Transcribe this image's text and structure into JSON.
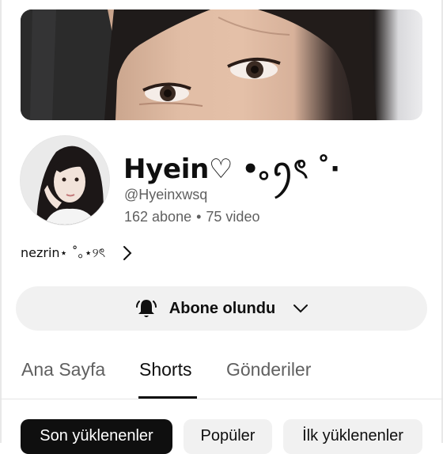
{
  "channel": {
    "name": "Hyein♡ •｡ꪆৎ ˚⋅",
    "handle": "@Hyeinxwsq",
    "subscribers": "162 abone",
    "separator": "•",
    "videos": "75 video",
    "link_text": "nezrin⋆ ˚｡⋆୨ৎ"
  },
  "subscribe": {
    "label": "Abone olundu",
    "icon": "bell-filled-icon"
  },
  "tabs": [
    {
      "label": "Ana Sayfa",
      "active": false
    },
    {
      "label": "Shorts",
      "active": true
    },
    {
      "label": "Gönderiler",
      "active": false
    }
  ],
  "filters": [
    {
      "label": "Son yüklenenler",
      "selected": true
    },
    {
      "label": "Popüler",
      "selected": false
    },
    {
      "label": "İlk yüklenenler",
      "selected": false
    }
  ],
  "colors": {
    "text_primary": "#0f0f0f",
    "text_secondary": "#606060",
    "button_bg": "#f1f1f1",
    "chip_selected_bg": "#0f0f0f"
  }
}
